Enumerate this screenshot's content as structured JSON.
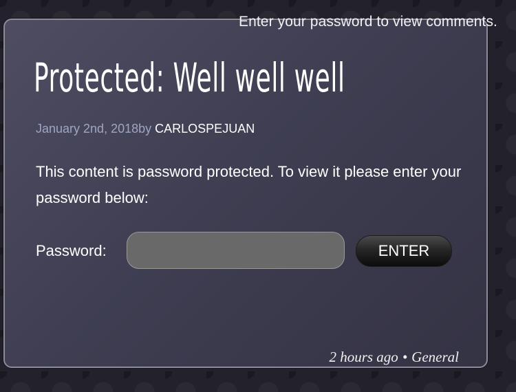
{
  "header": {
    "comments_notice": "Enter your password to view comments."
  },
  "post": {
    "title": "Protected: Well well well",
    "date": "January 2nd, 2018",
    "by_label": "by",
    "author": "CARLOSPEJUAN",
    "content": "This content is password protected. To view it please enter your password below:",
    "password_label": "Password:",
    "password_value": "",
    "submit_label": "ENTER",
    "footer": {
      "time_ago": "2 hours ago",
      "separator": "•",
      "category": "General"
    }
  },
  "colors": {
    "background": "#23212b",
    "panel": "#454458",
    "meta_date": "#9ea6c2",
    "input_fill": "#696969",
    "button": "#1c1c1c"
  }
}
